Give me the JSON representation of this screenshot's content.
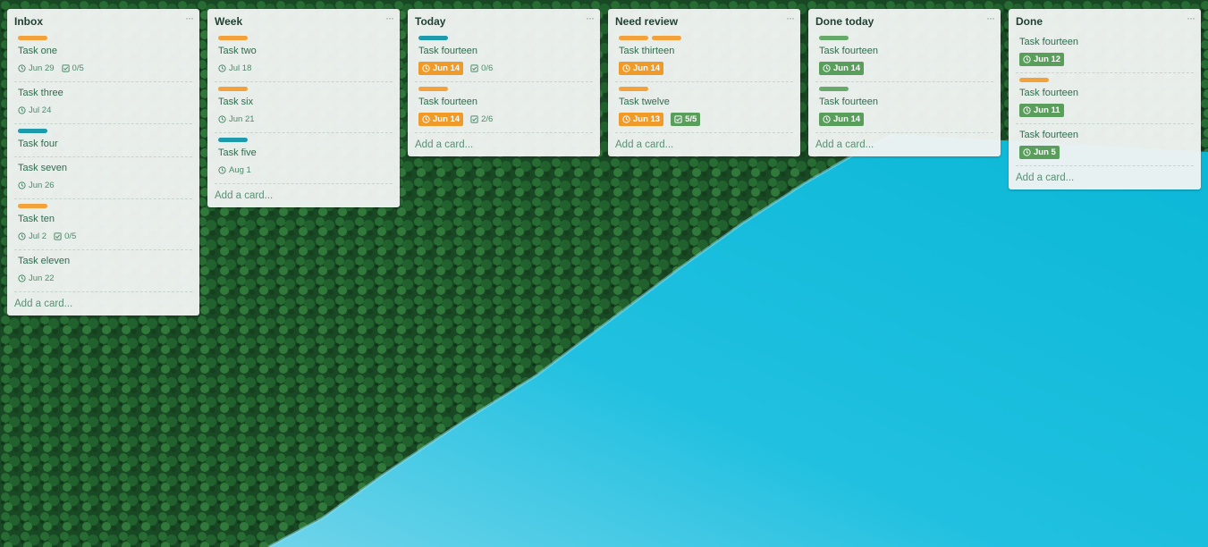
{
  "board": {
    "lists": [
      {
        "title": "Inbox",
        "menu": "···",
        "add_card": "Add a card...",
        "cards": [
          {
            "labels": [
              "orange"
            ],
            "title": "Task one",
            "due": "Jun 29",
            "due_style": "plain",
            "checklist": "0/5",
            "check_style": "plain"
          },
          {
            "labels": [],
            "title": "Task three",
            "due": "Jul 24",
            "due_style": "plain"
          },
          {
            "labels": [
              "teal"
            ],
            "title": "Task four"
          },
          {
            "labels": [],
            "title": "Task seven",
            "due": "Jun 26",
            "due_style": "plain"
          },
          {
            "labels": [
              "orange"
            ],
            "title": "Task ten",
            "due": "Jul 2",
            "due_style": "plain",
            "checklist": "0/5",
            "check_style": "plain"
          },
          {
            "labels": [],
            "title": "Task eleven",
            "due": "Jun 22",
            "due_style": "plain"
          }
        ]
      },
      {
        "title": "Week",
        "menu": "···",
        "add_card": "Add a card...",
        "cards": [
          {
            "labels": [
              "orange"
            ],
            "title": "Task two",
            "due": "Jul 18",
            "due_style": "plain"
          },
          {
            "labels": [
              "orange"
            ],
            "title": "Task six",
            "due": "Jun 21",
            "due_style": "plain"
          },
          {
            "labels": [
              "teal"
            ],
            "title": "Task five",
            "due": "Aug 1",
            "due_style": "plain"
          }
        ]
      },
      {
        "title": "Today",
        "menu": "···",
        "add_card": "Add a card...",
        "cards": [
          {
            "labels": [
              "teal"
            ],
            "title": "Task fourteen",
            "due": "Jun 14",
            "due_style": "orange",
            "checklist": "0/6",
            "check_style": "plain"
          },
          {
            "labels": [
              "orange"
            ],
            "title": "Task fourteen",
            "due": "Jun 14",
            "due_style": "orange",
            "checklist": "2/6",
            "check_style": "plain"
          }
        ]
      },
      {
        "title": "Need review",
        "menu": "···",
        "add_card": "Add a card...",
        "cards": [
          {
            "labels": [
              "orange",
              "orange"
            ],
            "title": "Task thirteen",
            "due": "Jun 14",
            "due_style": "orange"
          },
          {
            "labels": [
              "orange"
            ],
            "title": "Task twelve",
            "due": "Jun 13",
            "due_style": "orange",
            "checklist": "5/5",
            "check_style": "green"
          }
        ]
      },
      {
        "title": "Done today",
        "menu": "···",
        "add_card": "Add a card...",
        "cards": [
          {
            "labels": [
              "green"
            ],
            "title": "Task fourteen",
            "due": "Jun 14",
            "due_style": "green"
          },
          {
            "labels": [
              "green"
            ],
            "title": "Task fourteen",
            "due": "Jun 14",
            "due_style": "green"
          }
        ]
      },
      {
        "title": "Done",
        "menu": "···",
        "add_card": "Add a card...",
        "cards": [
          {
            "labels": [],
            "title": "Task fourteen",
            "due": "Jun 12",
            "due_style": "green"
          },
          {
            "labels": [
              "orange"
            ],
            "title": "Task fourteen",
            "due": "Jun 11",
            "due_style": "green"
          },
          {
            "labels": [],
            "title": "Task fourteen",
            "due": "Jun 5",
            "due_style": "green"
          }
        ]
      }
    ]
  },
  "colors": {
    "label_orange": "#f3a13b",
    "label_green": "#67a96a",
    "label_teal": "#1e9aad",
    "due_orange": "#f09a2a",
    "due_green": "#5a9e5c",
    "forest": "#1f5a2c",
    "water": "#14bcd9"
  },
  "icons": {
    "due": "clock-icon",
    "checklist": "checkbox-icon",
    "list_menu": "more-icon"
  }
}
